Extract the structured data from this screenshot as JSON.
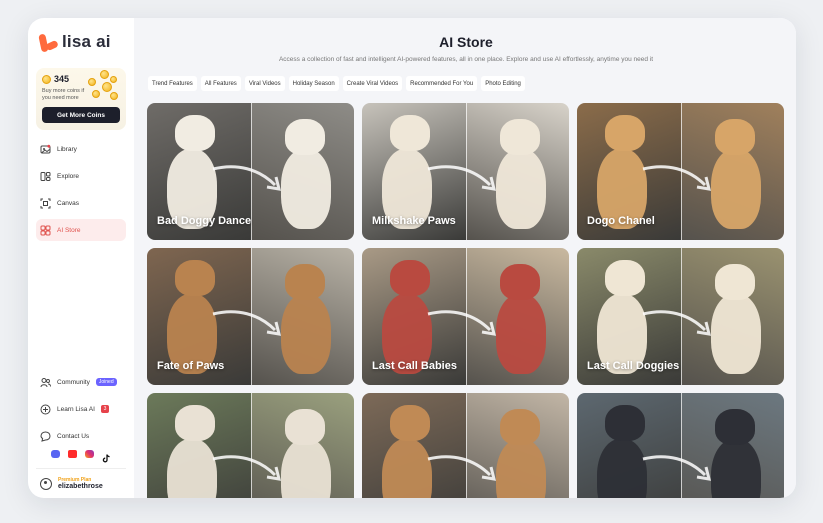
{
  "sidebar": {
    "logo_text": "lisa ai",
    "coins": {
      "count": "345",
      "note": "Buy more coins if you need more",
      "button": "Get More Coins"
    },
    "nav": [
      {
        "label": "Library",
        "icon": "library-icon"
      },
      {
        "label": "Explore",
        "icon": "explore-icon"
      },
      {
        "label": "Canvas",
        "icon": "canvas-icon"
      },
      {
        "label": "AI Store",
        "icon": "store-icon",
        "active": true
      }
    ],
    "community": {
      "label": "Community",
      "badge": "Joined"
    },
    "learn": {
      "label": "Learn Lisa AI",
      "badge": "3"
    },
    "contact": {
      "label": "Contact Us"
    },
    "socials": [
      "discord-icon",
      "youtube-icon",
      "instagram-icon",
      "tiktok-icon"
    ],
    "profile": {
      "plan": "Premium Plan",
      "username": "elizabethrose"
    }
  },
  "main": {
    "title": "AI Store",
    "subtitle": "Access a collection of fast and intelligent AI-powered features, all in one place. Explore and use AI effortlessly, anytime you need it",
    "tabs": [
      "Trend Features",
      "All Features",
      "Viral Videos",
      "Holiday Season",
      "Create Viral Videos",
      "Recommended For You",
      "Photo Editing"
    ],
    "cards": [
      {
        "title": "Bad Doggy Dance",
        "left": "#6f6c68",
        "right": "#8e8c87",
        "subject": "#f1ece2"
      },
      {
        "title": "Milkshake Paws",
        "left": "#c7c3bb",
        "right": "#d8d3ca",
        "subject": "#efe7d8"
      },
      {
        "title": "Dogo Chanel",
        "left": "#8b6c4a",
        "right": "#a0805c",
        "subject": "#d7a568"
      },
      {
        "title": "Fate of Paws",
        "left": "#7f6650",
        "right": "#b8b2a6",
        "subject": "#b9834f"
      },
      {
        "title": "Last Call Babies",
        "left": "#a99a86",
        "right": "#c9b9a0",
        "subject": "#b94a40"
      },
      {
        "title": "Last Call Doggies",
        "left": "#8a8a6a",
        "right": "#9a9270",
        "subject": "#efe6d4"
      },
      {
        "title": "",
        "left": "#6c7a5a",
        "right": "#9aa07e",
        "subject": "#e9e1d4"
      },
      {
        "title": "",
        "left": "#7d6a58",
        "right": "#c2b6a6",
        "subject": "#c08a55"
      },
      {
        "title": "",
        "left": "#5d6870",
        "right": "#6c7880",
        "subject": "#2d2f36"
      }
    ]
  }
}
